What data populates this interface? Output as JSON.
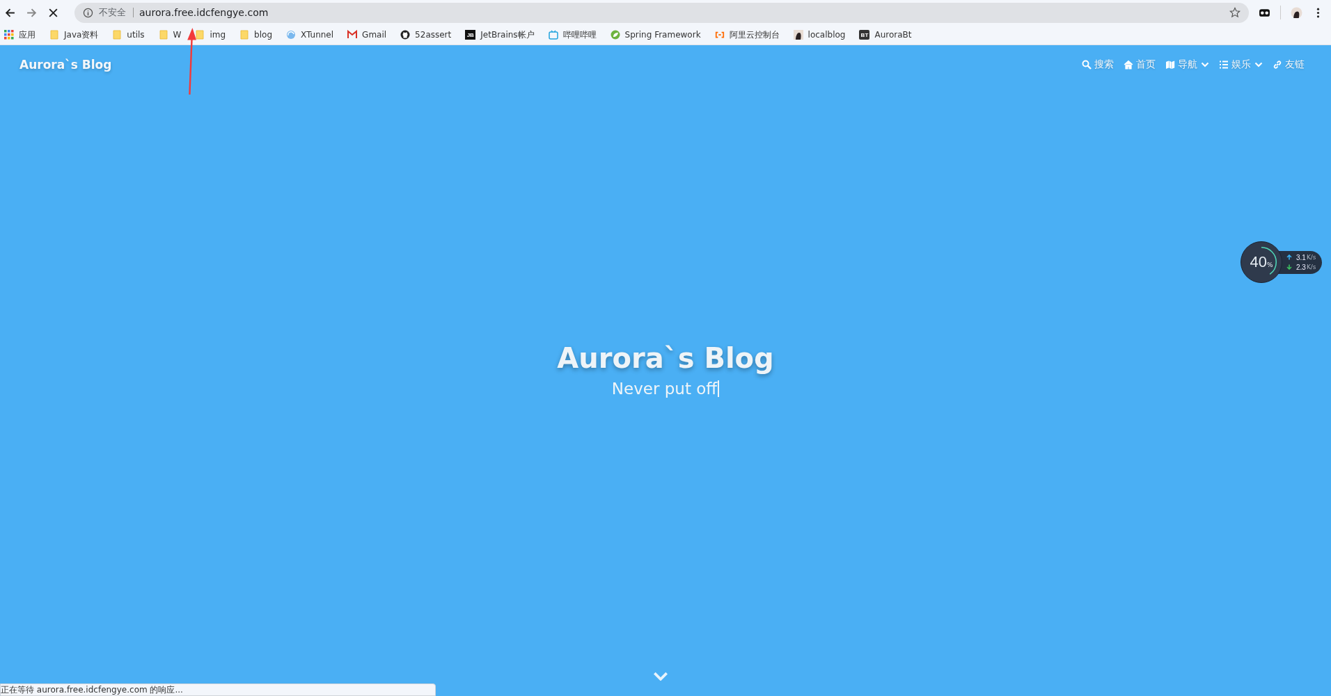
{
  "browser": {
    "loading": true,
    "security_label": "不安全",
    "url": "aurora.free.idcfengye.com",
    "starred": false
  },
  "bookmarks": [
    {
      "kind": "apps",
      "label": "应用"
    },
    {
      "kind": "folder",
      "label": "Java资料"
    },
    {
      "kind": "folder",
      "label": "utils"
    },
    {
      "kind": "folder",
      "label": "W"
    },
    {
      "kind": "folder",
      "label": "img"
    },
    {
      "kind": "folder",
      "label": "blog"
    },
    {
      "kind": "globe",
      "label": "XTunnel"
    },
    {
      "kind": "gmail",
      "label": "Gmail"
    },
    {
      "kind": "github",
      "label": "52assert"
    },
    {
      "kind": "jb",
      "label": "JetBrains帐户",
      "badge": "JB"
    },
    {
      "kind": "tv",
      "label": "哔哩哔哩"
    },
    {
      "kind": "spring",
      "label": "Spring Framework"
    },
    {
      "kind": "cloud",
      "label": "阿里云控制台"
    },
    {
      "kind": "avatar",
      "label": "localblog"
    },
    {
      "kind": "bt",
      "label": "AuroraBt",
      "badge": "BT"
    }
  ],
  "site": {
    "brand": "Aurora`s Blog",
    "nav": [
      {
        "kind": "search",
        "label": "搜索",
        "dropdown": false
      },
      {
        "kind": "home",
        "label": "首页",
        "dropdown": false
      },
      {
        "kind": "map",
        "label": "导航",
        "dropdown": true
      },
      {
        "kind": "list",
        "label": "娱乐",
        "dropdown": true
      },
      {
        "kind": "link",
        "label": "友链",
        "dropdown": false
      }
    ],
    "title": "Aurora`s Blog",
    "subtitle": "Never put off"
  },
  "net_widget": {
    "percent": "40",
    "unit": "%",
    "level": 0.4,
    "upload": "3.1",
    "upload_unit": "K/s",
    "download": "2.3",
    "download_unit": "K/s"
  },
  "status_bar": "正在等待 aurora.free.idcfengye.com 的响应..."
}
